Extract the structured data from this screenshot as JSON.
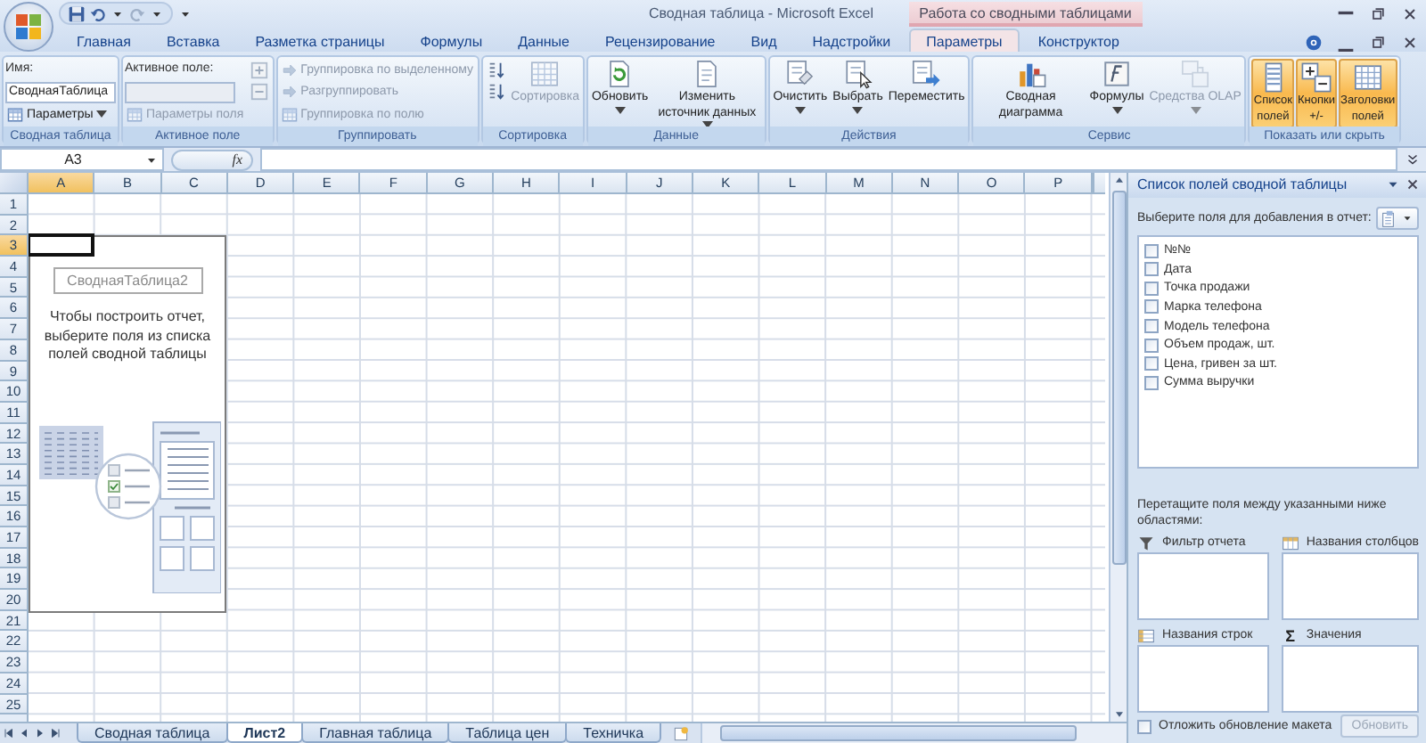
{
  "window": {
    "title": "Сводная таблица - Microsoft Excel"
  },
  "ribbon_tabs": [
    {
      "label": "Главная",
      "selected": false
    },
    {
      "label": "Вставка",
      "selected": false
    },
    {
      "label": "Разметка страницы",
      "selected": false
    },
    {
      "label": "Формулы",
      "selected": false
    },
    {
      "label": "Данные",
      "selected": false
    },
    {
      "label": "Рецензирование",
      "selected": false
    },
    {
      "label": "Вид",
      "selected": false
    },
    {
      "label": "Надстройки",
      "selected": false
    }
  ],
  "context_tabs": {
    "label": "Работа со сводными таблицами",
    "tabs": [
      {
        "label": "Параметры",
        "selected": true
      },
      {
        "label": "Конструктор",
        "selected": false
      }
    ]
  },
  "ribbon_groups": [
    {
      "label": "Сводная таблица",
      "items": [
        {
          "kind": "label",
          "label": "Имя:",
          "disabled": false
        },
        {
          "kind": "field",
          "value": "СводнаяТаблица",
          "disabled": false
        },
        {
          "kind": "small",
          "label": "Параметры",
          "disabled": false,
          "dropdown": true
        }
      ]
    },
    {
      "label": "Активное поле",
      "items": [
        {
          "kind": "label",
          "label": "Активное поле:",
          "disabled": false
        },
        {
          "kind": "field",
          "disabled": true
        },
        {
          "kind": "small",
          "label": "Параметры поля",
          "disabled": true,
          "dropdown": false
        },
        {
          "kind": "icon",
          "disabled": true,
          "dropdown": false
        },
        {
          "kind": "icon",
          "disabled": true,
          "dropdown": false
        }
      ]
    },
    {
      "label": "Группировать",
      "items": [
        {
          "kind": "small",
          "label": "Группировка по выделенному",
          "disabled": true,
          "dropdown": false
        },
        {
          "kind": "small",
          "label": "Разгруппировать",
          "disabled": true,
          "dropdown": false
        },
        {
          "kind": "small",
          "label": "Группировка по полю",
          "disabled": true,
          "dropdown": false
        }
      ]
    },
    {
      "label": "Сортировка",
      "items": [
        {
          "kind": "icon",
          "disabled": false,
          "dropdown": false
        },
        {
          "kind": "icon",
          "disabled": false,
          "dropdown": false
        },
        {
          "kind": "large",
          "label": "Сортировка",
          "disabled": true,
          "dropdown": false
        }
      ]
    },
    {
      "label": "Данные",
      "items": [
        {
          "kind": "large",
          "label": "Обновить",
          "disabled": false,
          "dropdown": true
        },
        {
          "kind": "large",
          "label": "Изменить источник данных",
          "disabled": false,
          "dropdown": true
        }
      ]
    },
    {
      "label": "Действия",
      "items": [
        {
          "kind": "large",
          "label": "Очистить",
          "disabled": false,
          "dropdown": true
        },
        {
          "kind": "large",
          "label": "Выбрать",
          "disabled": false,
          "dropdown": true
        },
        {
          "kind": "large",
          "label": "Переместить",
          "disabled": false,
          "dropdown": false
        }
      ]
    },
    {
      "label": "Сервис",
      "items": [
        {
          "kind": "large",
          "label": "Сводная диаграмма",
          "disabled": false,
          "dropdown": false
        },
        {
          "kind": "large",
          "label": "Формулы",
          "disabled": false,
          "dropdown": true
        },
        {
          "kind": "large",
          "label": "Средства OLAP",
          "disabled": true,
          "dropdown": true
        }
      ]
    },
    {
      "label": "Показать или скрыть",
      "items": [
        {
          "kind": "toggle",
          "label": "Список полей",
          "on": true,
          "disabled": false
        },
        {
          "kind": "toggle",
          "label": "Кнопки +/-",
          "on": true,
          "disabled": false
        },
        {
          "kind": "toggle",
          "label": "Заголовки полей",
          "on": true,
          "disabled": false
        }
      ]
    }
  ],
  "formula_bar": {
    "name_box": "A3",
    "function_button": "fx"
  },
  "columns": [
    {
      "label": "A",
      "selected": true
    },
    {
      "label": "B",
      "selected": false
    },
    {
      "label": "C",
      "selected": false
    },
    {
      "label": "D",
      "selected": false
    },
    {
      "label": "E",
      "selected": false
    },
    {
      "label": "F",
      "selected": false
    },
    {
      "label": "G",
      "selected": false
    },
    {
      "label": "H",
      "selected": false
    },
    {
      "label": "I",
      "selected": false
    },
    {
      "label": "J",
      "selected": false
    },
    {
      "label": "K",
      "selected": false
    },
    {
      "label": "L",
      "selected": false
    },
    {
      "label": "M",
      "selected": false
    },
    {
      "label": "N",
      "selected": false
    },
    {
      "label": "O",
      "selected": false
    },
    {
      "label": "P",
      "selected": false
    }
  ],
  "rows": [
    {
      "label": "1",
      "selected": false
    },
    {
      "label": "2",
      "selected": false
    },
    {
      "label": "3",
      "selected": true
    },
    {
      "label": "4",
      "selected": false
    },
    {
      "label": "5",
      "selected": false
    },
    {
      "label": "6",
      "selected": false
    },
    {
      "label": "7",
      "selected": false
    },
    {
      "label": "8",
      "selected": false
    },
    {
      "label": "9",
      "selected": false
    },
    {
      "label": "10",
      "selected": false
    },
    {
      "label": "11",
      "selected": false
    },
    {
      "label": "12",
      "selected": false
    },
    {
      "label": "13",
      "selected": false
    },
    {
      "label": "14",
      "selected": false
    },
    {
      "label": "15",
      "selected": false
    },
    {
      "label": "16",
      "selected": false
    },
    {
      "label": "17",
      "selected": false
    },
    {
      "label": "18",
      "selected": false
    },
    {
      "label": "19",
      "selected": false
    },
    {
      "label": "20",
      "selected": false
    },
    {
      "label": "21",
      "selected": false
    },
    {
      "label": "22",
      "selected": false
    },
    {
      "label": "23",
      "selected": false
    },
    {
      "label": "24",
      "selected": false
    },
    {
      "label": "25",
      "selected": false
    }
  ],
  "pivot_placeholder": {
    "name": "СводнаяТаблица2",
    "hint": "Чтобы построить отчет, выберите поля из списка полей сводной таблицы"
  },
  "field_list": {
    "title": "Список полей сводной таблицы",
    "prompt": "Выберите поля для добавления в отчет:",
    "fields": [
      {
        "label": "№№",
        "checked": false
      },
      {
        "label": "Дата",
        "checked": false
      },
      {
        "label": "Точка продажи",
        "checked": false
      },
      {
        "label": "Марка телефона",
        "checked": false
      },
      {
        "label": "Модель телефона",
        "checked": false
      },
      {
        "label": "Объем продаж, шт.",
        "checked": false
      },
      {
        "label": "Цена, гривен за шт.",
        "checked": false
      },
      {
        "label": "Сумма выручки",
        "checked": false
      }
    ],
    "drag_hint": "Перетащите поля между указанными ниже областями:",
    "areas": [
      {
        "kind": "filter",
        "label": "Фильтр отчета"
      },
      {
        "kind": "columns",
        "label": "Названия столбцов"
      },
      {
        "kind": "rows",
        "label": "Названия строк"
      },
      {
        "kind": "values",
        "label": "Значения",
        "symbol": "Σ"
      }
    ],
    "defer_update": {
      "label": "Отложить обновление макета",
      "checked": false
    },
    "update_button": {
      "label": "Обновить",
      "disabled": true
    }
  },
  "sheet_tabs": [
    {
      "label": "Сводная таблица",
      "selected": false
    },
    {
      "label": "Лист2",
      "selected": true
    },
    {
      "label": "Главная таблица",
      "selected": false
    },
    {
      "label": "Таблица цен",
      "selected": false
    },
    {
      "label": "Техничка",
      "selected": false
    }
  ]
}
